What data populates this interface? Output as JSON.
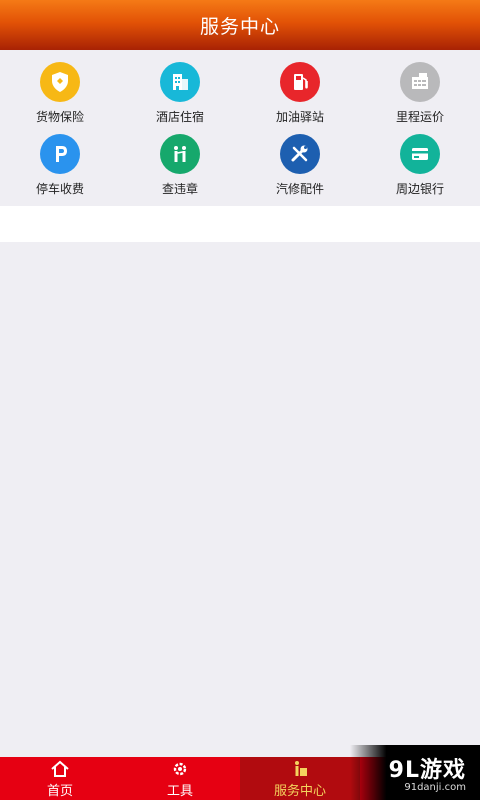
{
  "header": {
    "title": "服务中心"
  },
  "services": [
    {
      "label": "货物保险",
      "icon": "shield-icon",
      "color": "#f7b815"
    },
    {
      "label": "酒店住宿",
      "icon": "hotel-icon",
      "color": "#18b8d8"
    },
    {
      "label": "加油驿站",
      "icon": "fuel-pump-icon",
      "color": "#e8262b"
    },
    {
      "label": "里程运价",
      "icon": "calculator-icon",
      "color": "#b9b9bb"
    },
    {
      "label": "停车收费",
      "icon": "parking-icon",
      "color": "#2a93ee"
    },
    {
      "label": "查违章",
      "icon": "traffic-police-icon",
      "color": "#16a86c"
    },
    {
      "label": "汽修配件",
      "icon": "wrench-screwdriver-icon",
      "color": "#1d5fb0"
    },
    {
      "label": "周边银行",
      "icon": "bank-card-icon",
      "color": "#12b39a"
    }
  ],
  "tabbar": {
    "tabs": [
      {
        "label": "首页",
        "icon": "home-icon"
      },
      {
        "label": "工具",
        "icon": "gear-icon"
      },
      {
        "label": "服务中心",
        "icon": "service-icon",
        "active": true
      }
    ]
  },
  "watermark": {
    "logo": "9L游戏",
    "url": "91danji.com"
  }
}
